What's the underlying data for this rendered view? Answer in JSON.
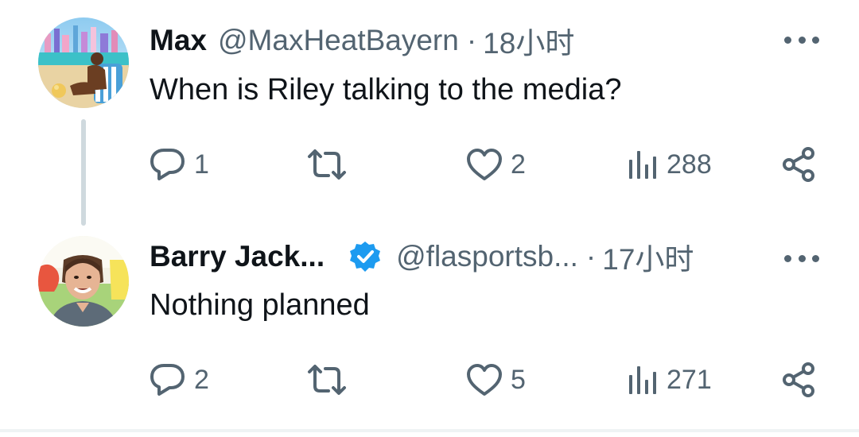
{
  "tweets": [
    {
      "name": "Max",
      "handle": "@MaxHeatBayern",
      "separator": "·",
      "time": "18小时",
      "text": "When is Riley talking to the media?",
      "verified": false,
      "replies": "1",
      "retweets": "",
      "likes": "2",
      "views": "288"
    },
    {
      "name": "Barry Jack...",
      "handle": "@flasportsb...",
      "separator": "·",
      "time": "17小时",
      "text": "Nothing planned",
      "verified": true,
      "replies": "2",
      "retweets": "",
      "likes": "5",
      "views": "271"
    }
  ],
  "icons": {
    "reply": "reply-icon",
    "retweet": "retweet-icon",
    "like": "heart-icon",
    "views": "views-icon",
    "share": "share-icon",
    "more": "more-icon",
    "verified": "verified-badge-icon"
  },
  "colors": {
    "text": "#0f1419",
    "secondary": "#536471",
    "verified": "#1d9bf0",
    "thread_line": "#cfd9de"
  }
}
